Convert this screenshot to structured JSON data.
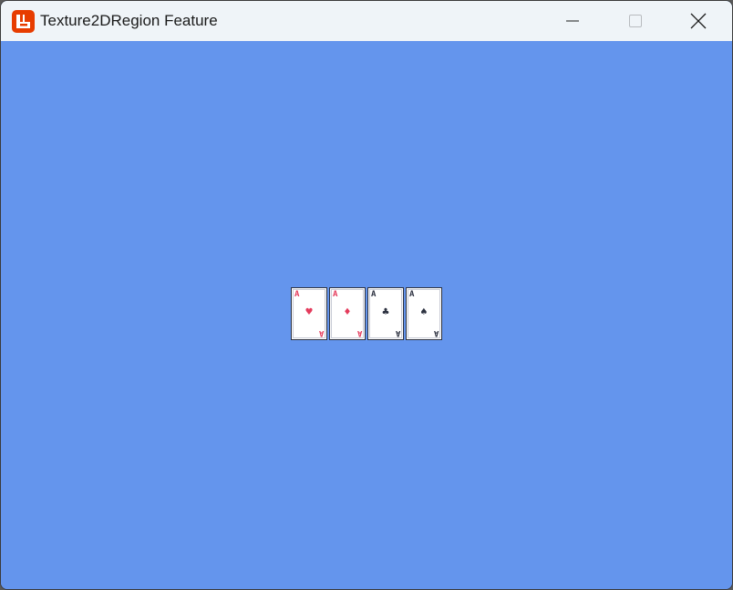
{
  "window": {
    "title": "Texture2DRegion Feature",
    "background_color": "#6495ed",
    "titlebar_color": "#eff4f8"
  },
  "titlebar": {
    "app_icon": "monogame-logo-icon",
    "app_icon_color": "#e73c00",
    "controls": [
      "minimize-icon",
      "maximize-icon",
      "close-icon"
    ]
  },
  "cards": [
    {
      "rank": "A",
      "suit": "♥",
      "suit_name": "hearts",
      "color": "#e43b5c"
    },
    {
      "rank": "A",
      "suit": "♦",
      "suit_name": "diamonds",
      "color": "#e43b5c"
    },
    {
      "rank": "A",
      "suit": "♣",
      "suit_name": "clubs",
      "color": "#2c3140"
    },
    {
      "rank": "A",
      "suit": "♠",
      "suit_name": "spades",
      "color": "#2c3140"
    }
  ]
}
